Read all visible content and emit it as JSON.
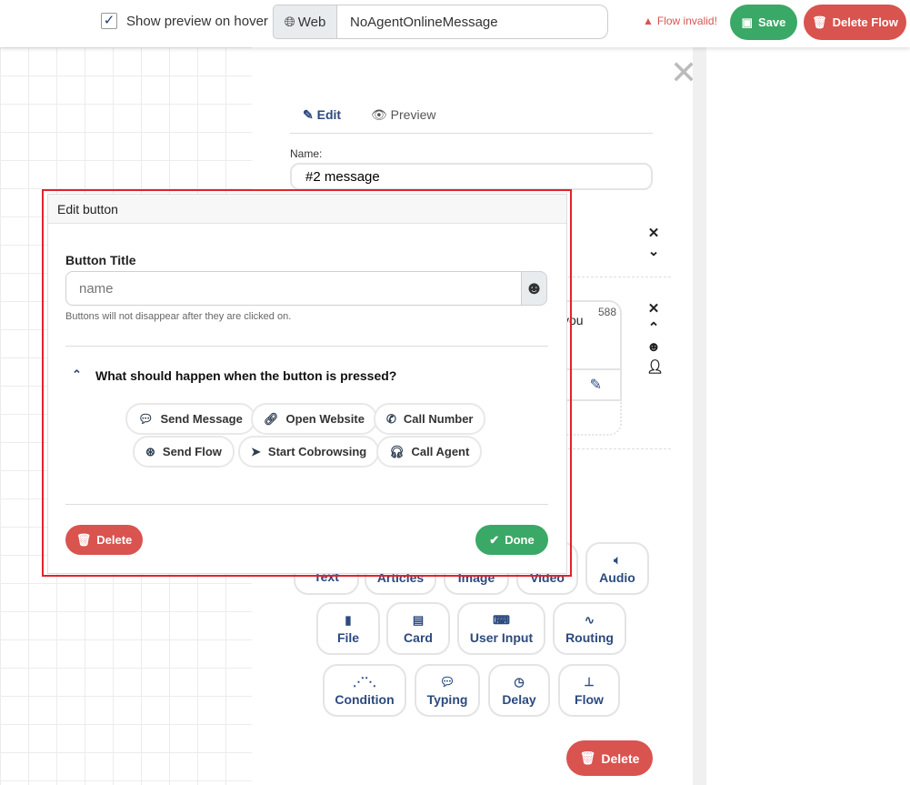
{
  "topbar": {
    "show_preview_label": "Show preview on hover",
    "show_preview_checked": true,
    "channel_label": "Web",
    "flow_name": "NoAgentOnlineMessage",
    "flow_status": "Flow invalid!",
    "save_label": "Save",
    "delete_flow_label": "Delete Flow"
  },
  "panel": {
    "tabs": [
      {
        "label": "Edit",
        "active": true
      },
      {
        "label": "Preview",
        "active": false
      }
    ],
    "name_label": "Name:",
    "name_value": "#2 message",
    "text_snippet": "you",
    "char_counter": "588",
    "blocks": [
      {
        "label": "Text",
        "icon": "text-icon"
      },
      {
        "label": "Articles",
        "icon": "articles-icon"
      },
      {
        "label": "Image",
        "icon": "image-icon"
      },
      {
        "label": "Video",
        "icon": "video-icon"
      },
      {
        "label": "Audio",
        "icon": "volume-icon"
      },
      {
        "label": "File",
        "icon": "file-icon"
      },
      {
        "label": "Card",
        "icon": "id-card-icon"
      },
      {
        "label": "User Input",
        "icon": "keyboard-icon"
      },
      {
        "label": "Routing",
        "icon": "route-icon"
      },
      {
        "label": "Condition",
        "icon": "condition-icon"
      },
      {
        "label": "Typing",
        "icon": "comment-dots-icon"
      },
      {
        "label": "Delay",
        "icon": "clock-icon"
      },
      {
        "label": "Flow",
        "icon": "sitemap-icon"
      }
    ],
    "delete_label": "Delete"
  },
  "modal": {
    "title": "Edit button",
    "field_label": "Button Title",
    "field_placeholder": "name",
    "field_value": "",
    "help_text": "Buttons will not disappear after they are clicked on.",
    "section_title": "What should happen when the button is pressed?",
    "actions": [
      {
        "label": "Send Message",
        "icon": "comment-icon"
      },
      {
        "label": "Open Website",
        "icon": "link-icon"
      },
      {
        "label": "Call Number",
        "icon": "phone-icon"
      },
      {
        "label": "Send Flow",
        "icon": "flow-icon"
      },
      {
        "label": "Start Cobrowsing",
        "icon": "pointer-icon"
      },
      {
        "label": "Call Agent",
        "icon": "headset-icon"
      }
    ],
    "delete_label": "Delete",
    "done_label": "Done"
  },
  "colors": {
    "green": "#3aa866",
    "red": "#d9534f",
    "navy": "#2c4a7e",
    "highlight": "#e3222a"
  }
}
